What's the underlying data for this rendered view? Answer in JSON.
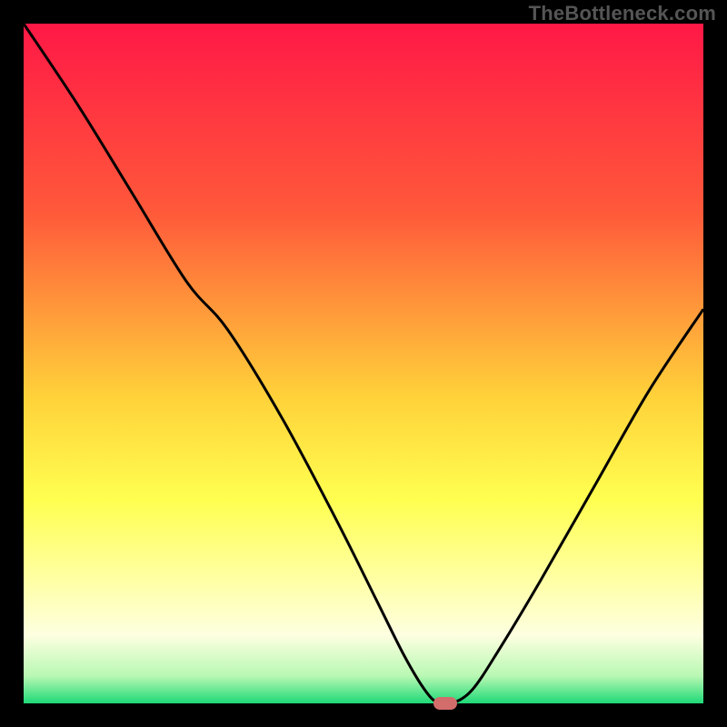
{
  "watermark": "TheBottleneck.com",
  "chart_data": {
    "type": "line",
    "title": "",
    "xlabel": "",
    "ylabel": "",
    "xlim": [
      0,
      100
    ],
    "ylim": [
      0,
      100
    ],
    "background_gradient": {
      "stops": [
        {
          "offset": 0,
          "color": "#ff1846"
        },
        {
          "offset": 28,
          "color": "#ff5a3a"
        },
        {
          "offset": 55,
          "color": "#ffd23a"
        },
        {
          "offset": 70,
          "color": "#ffff50"
        },
        {
          "offset": 82,
          "color": "#ffffa6"
        },
        {
          "offset": 90,
          "color": "#fdffe0"
        },
        {
          "offset": 96,
          "color": "#b8f8b3"
        },
        {
          "offset": 100,
          "color": "#1ed977"
        }
      ]
    },
    "series": [
      {
        "name": "bottleneck-curve",
        "color": "#000000",
        "x": [
          0,
          8,
          16,
          24,
          30,
          38,
          46,
          52,
          56,
          59,
          61,
          63,
          66,
          70,
          76,
          84,
          92,
          100
        ],
        "y": [
          100,
          88,
          75,
          62,
          55,
          42,
          27,
          15,
          7,
          2,
          0,
          0,
          2,
          8,
          18,
          32,
          46,
          58
        ]
      }
    ],
    "marker": {
      "x": 62,
      "y": 0,
      "color": "#d36d6b"
    }
  }
}
